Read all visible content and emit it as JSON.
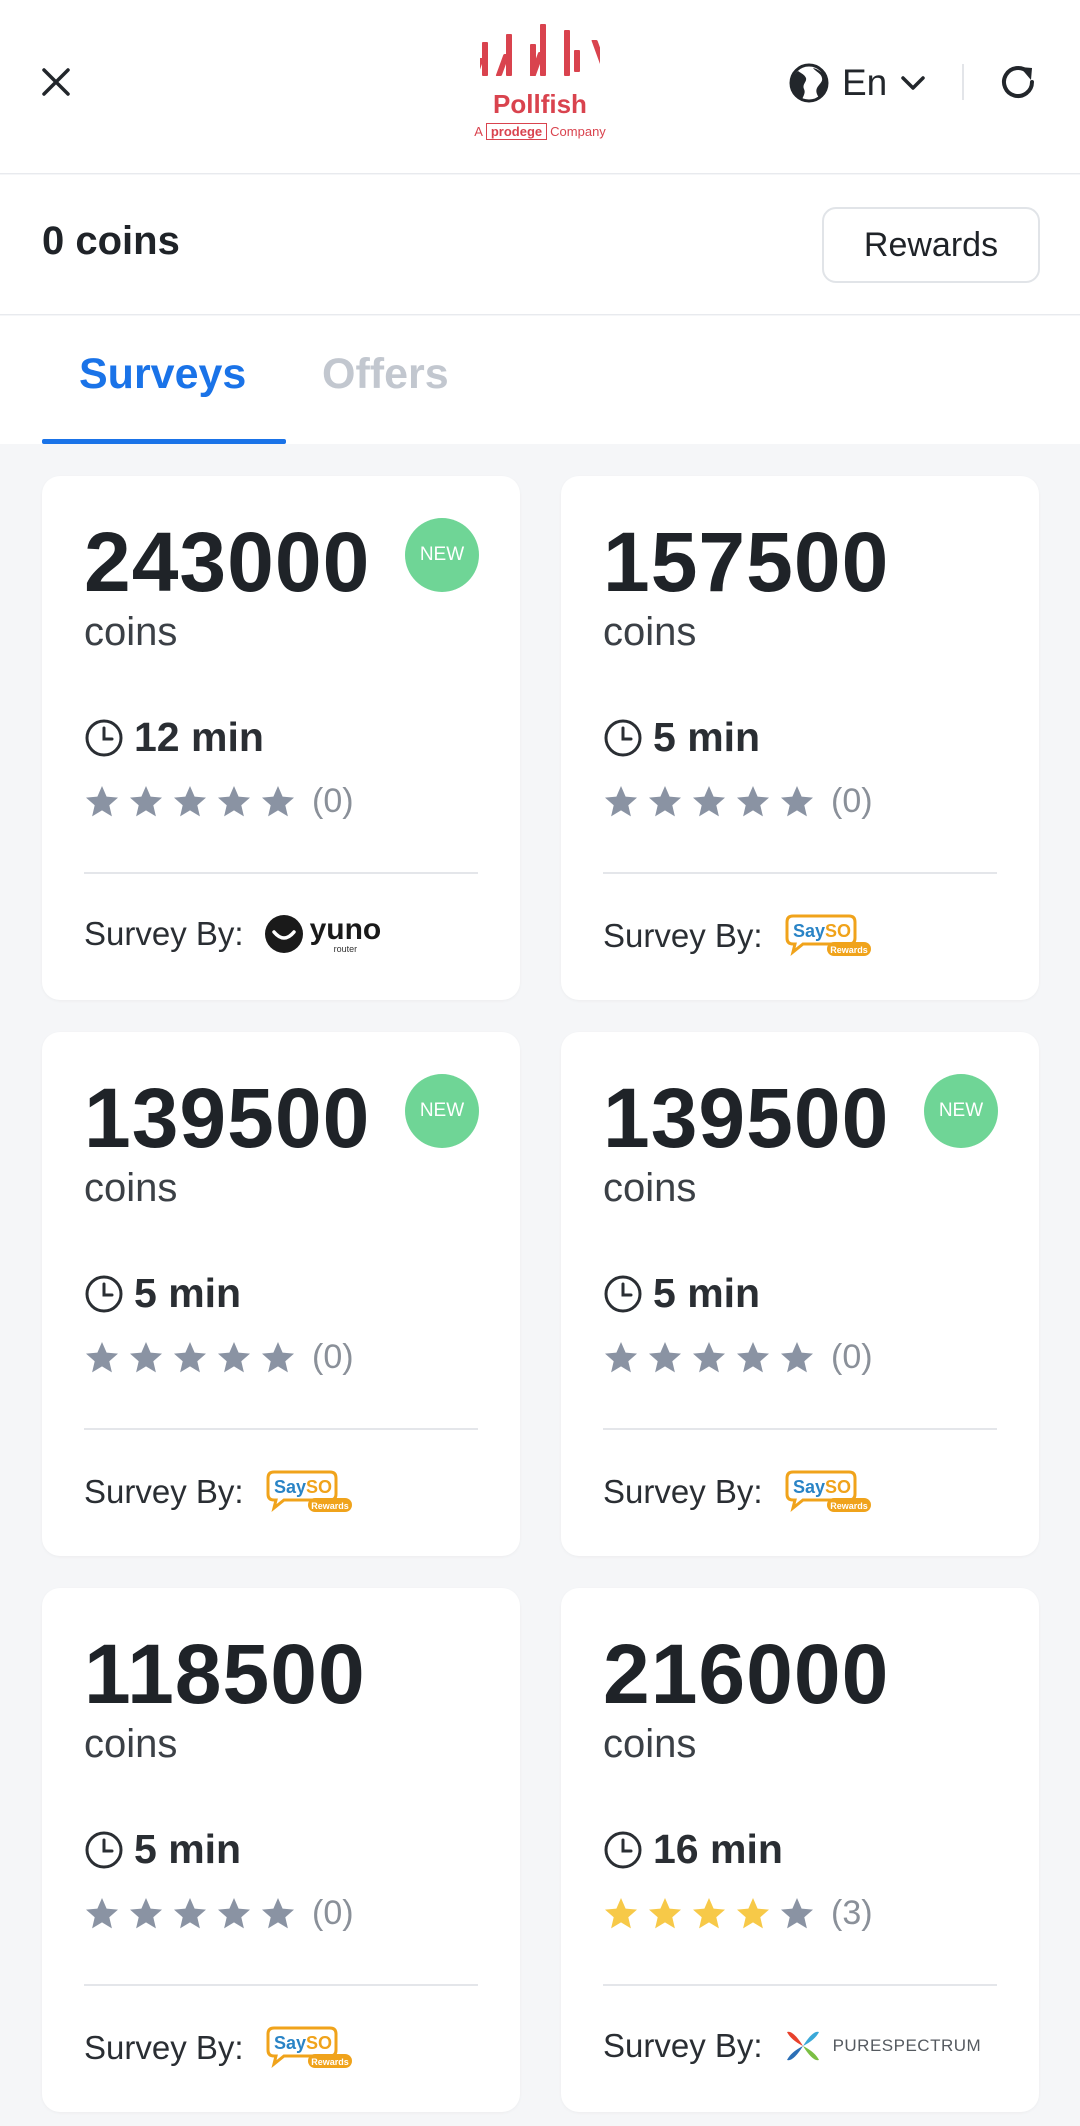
{
  "header": {
    "close_icon": "close-icon",
    "logo": {
      "brand": "Pollfish",
      "company_prefix": "A",
      "company_pro": "prodege",
      "company_suffix": "Company"
    },
    "language": {
      "icon": "globe-icon",
      "label": "En",
      "chevron": "chevron-down-icon"
    },
    "refresh_icon": "refresh-icon"
  },
  "balance": {
    "coins_text": "0 coins",
    "rewards_label": "Rewards"
  },
  "tabs": [
    {
      "label": "Surveys",
      "active": true
    },
    {
      "label": "Offers",
      "active": false
    }
  ],
  "colors": {
    "accent": "#1a73e8",
    "badge": "#6fd596",
    "star_empty": "#8a93a3",
    "star_filled": "#f7c948",
    "brand": "#d9434e"
  },
  "surveys": [
    {
      "amount": "243000",
      "unit": "coins",
      "is_new": true,
      "badge": "NEW",
      "time": "12 min",
      "stars_filled": 0,
      "rating_count": "(0)",
      "by_label": "Survey By:",
      "provider": "yuno"
    },
    {
      "amount": "157500",
      "unit": "coins",
      "is_new": false,
      "badge": "",
      "time": "5 min",
      "stars_filled": 0,
      "rating_count": "(0)",
      "by_label": "Survey By:",
      "provider": "sayso"
    },
    {
      "amount": "139500",
      "unit": "coins",
      "is_new": true,
      "badge": "NEW",
      "time": "5 min",
      "stars_filled": 0,
      "rating_count": "(0)",
      "by_label": "Survey By:",
      "provider": "sayso"
    },
    {
      "amount": "139500",
      "unit": "coins",
      "is_new": true,
      "badge": "NEW",
      "time": "5 min",
      "stars_filled": 0,
      "rating_count": "(0)",
      "by_label": "Survey By:",
      "provider": "sayso"
    },
    {
      "amount": "118500",
      "unit": "coins",
      "is_new": false,
      "badge": "",
      "time": "5 min",
      "stars_filled": 0,
      "rating_count": "(0)",
      "by_label": "Survey By:",
      "provider": "sayso"
    },
    {
      "amount": "216000",
      "unit": "coins",
      "is_new": false,
      "badge": "",
      "time": "16 min",
      "stars_filled": 4,
      "rating_count": "(3)",
      "by_label": "Survey By:",
      "provider": "purespectrum"
    }
  ],
  "providers": {
    "yuno": {
      "name": "yuno",
      "sub": "router"
    },
    "sayso": {
      "name": "SaySo",
      "sub": "Rewards"
    },
    "purespectrum": {
      "name": "PURESPECTRUM"
    }
  }
}
